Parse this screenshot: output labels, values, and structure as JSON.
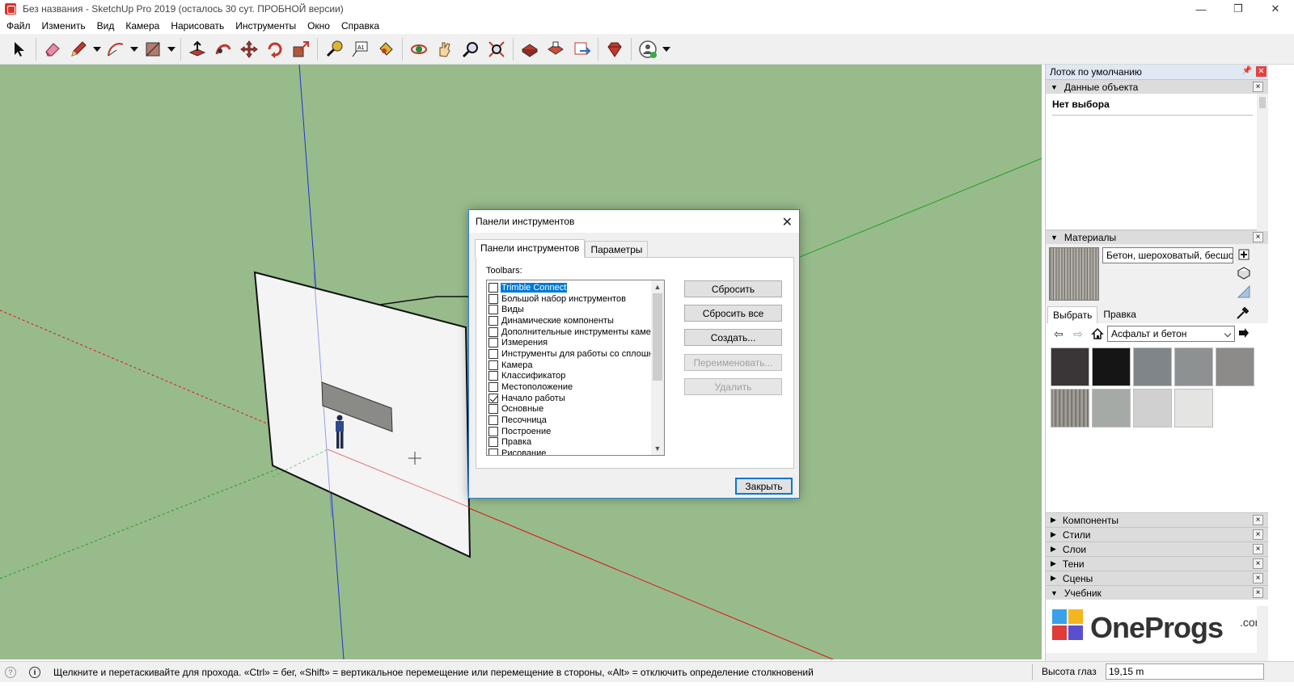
{
  "window": {
    "title": "Без названия - SketchUp Pro 2019 (осталось 30 сут. ПРОБНОЙ версии)",
    "controls": {
      "minimize": "—",
      "restore": "❐",
      "close": "✕"
    }
  },
  "menu": [
    "Файл",
    "Изменить",
    "Вид",
    "Камера",
    "Нарисовать",
    "Инструменты",
    "Окно",
    "Справка"
  ],
  "toolbar": {
    "tools": [
      "select-icon",
      "eraser-icon",
      "pencil-icon",
      "arc-icon",
      "rectangle-icon",
      "push-pull-icon",
      "follow-me-icon",
      "move-icon",
      "rotate-icon",
      "scale-icon",
      "tape-measure-icon",
      "text-icon",
      "paint-bucket-icon",
      "orbit-icon",
      "pan-icon",
      "zoom-icon",
      "zoom-extents-icon",
      "warehouse-icon",
      "extension-warehouse-icon",
      "layout-icon",
      "ruby-icon",
      "account-icon"
    ]
  },
  "tray": {
    "title": "Лоток по умолчанию",
    "entity_info": {
      "title": "Данные объекта",
      "value": "Нет выбора"
    },
    "materials": {
      "title": "Материалы",
      "current_name": "Бетон, шероховатый, бесшовный",
      "tabs": [
        "Выбрать",
        "Правка"
      ],
      "collection": "Асфальт и бетон",
      "swatches": [
        "#3a3536",
        "#151515",
        "#7f8588",
        "#8e9192",
        "#8c8b89",
        "#8a8680",
        "#a6aaa7",
        "#cfd0cf",
        "#e4e4e2"
      ]
    },
    "panels": [
      "Компоненты",
      "Стили",
      "Слои",
      "Тени",
      "Сцены",
      "Учебник"
    ],
    "logo": {
      "main": "OneProgs",
      "suffix": ".com"
    }
  },
  "dialog": {
    "title": "Панели инструментов",
    "tabs": [
      "Панели инструментов",
      "Параметры"
    ],
    "list_label": "Toolbars:",
    "items": [
      {
        "label": "Trimble Connect",
        "checked": false,
        "selected": true
      },
      {
        "label": "Большой набор инструментов",
        "checked": false
      },
      {
        "label": "Виды",
        "checked": false
      },
      {
        "label": "Динамические компоненты",
        "checked": false
      },
      {
        "label": "Дополнительные инструменты камеры",
        "checked": false
      },
      {
        "label": "Измерения",
        "checked": false
      },
      {
        "label": "Инструменты для работы со сплошными",
        "checked": false
      },
      {
        "label": "Камера",
        "checked": false
      },
      {
        "label": "Классификатор",
        "checked": false
      },
      {
        "label": "Местоположение",
        "checked": false
      },
      {
        "label": "Начало работы",
        "checked": true
      },
      {
        "label": "Основные",
        "checked": false
      },
      {
        "label": "Песочница",
        "checked": false
      },
      {
        "label": "Построение",
        "checked": false
      },
      {
        "label": "Правка",
        "checked": false
      },
      {
        "label": "Рисование",
        "checked": false
      }
    ],
    "buttons": {
      "reset": "Сбросить",
      "reset_all": "Сбросить все",
      "create": "Создать...",
      "rename": "Переименовать...",
      "delete": "Удалить",
      "close": "Закрыть"
    }
  },
  "status": {
    "hint": "Щелкните и перетаскивайте для прохода.  «Ctrl» = бег, «Shift» = вертикальное перемещение или перемещение в стороны, «Alt» = отключить определение столкновений",
    "measure_label": "Высота глаз",
    "measure_value": "19,15 m"
  },
  "colors": {
    "viewport": "#98bb8c",
    "accent": "#0078d7"
  }
}
